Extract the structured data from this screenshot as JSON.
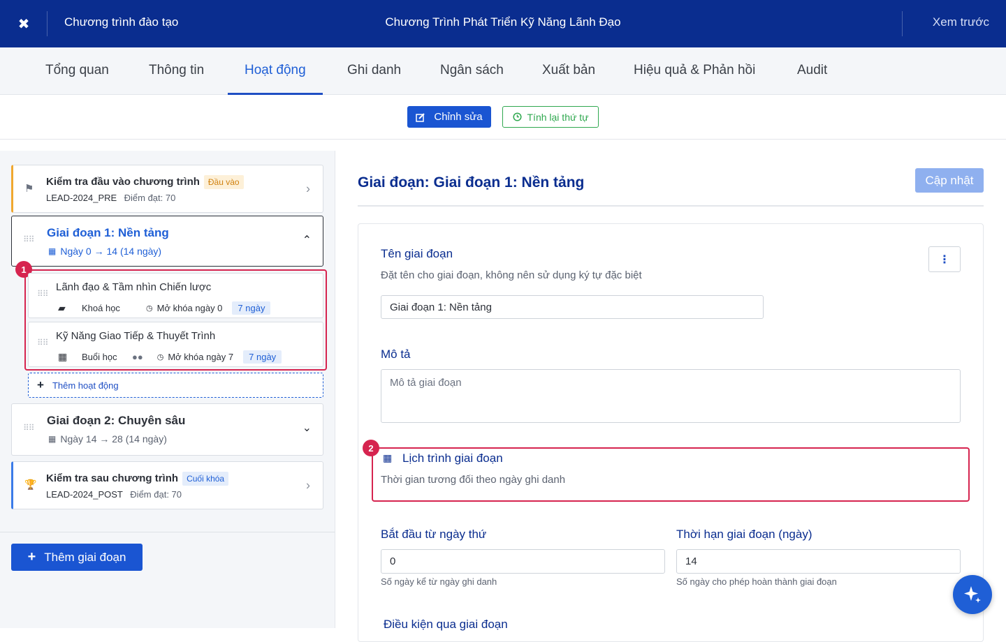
{
  "header": {
    "close_icon": "✖",
    "breadcrumb": "Chương trình đào tạo",
    "title": "Chương Trình Phát Triển Kỹ Năng Lãnh Đạo",
    "preview": "Xem trước"
  },
  "tabs": [
    {
      "label": "Tổng quan"
    },
    {
      "label": "Thông tin"
    },
    {
      "label": "Hoạt động"
    },
    {
      "label": "Ghi danh"
    },
    {
      "label": "Ngân sách"
    },
    {
      "label": "Xuất bản"
    },
    {
      "label": "Hiệu quả & Phản hồi"
    },
    {
      "label": "Audit"
    }
  ],
  "actions": {
    "edit": "Chỉnh sửa",
    "reorder": "Tính lại thứ tự"
  },
  "sidebar": {
    "pre_test": {
      "title": "Kiểm tra đầu vào chương trình",
      "badge": "Đầu vào",
      "code": "LEAD-2024_PRE",
      "score": "Điểm đạt: 70"
    },
    "phase1": {
      "title": "Giai đoạn 1: Nền tảng",
      "range": "Ngày 0 → 14 (14 ngày)",
      "activities": [
        {
          "title": "Lãnh đạo & Tầm nhìn Chiến lược",
          "type": "Khoá học",
          "unlock": "Mở khóa ngày 0",
          "days": "7 ngày"
        },
        {
          "title": "Kỹ Năng Giao Tiếp & Thuyết Trình",
          "type": "Buổi học",
          "unlock": "Mở khóa ngày 7",
          "days": "7 ngày"
        }
      ],
      "add_activity": "Thêm hoạt động"
    },
    "phase2": {
      "title": "Giai đoạn 2: Chuyên sâu",
      "range": "Ngày 14 → 28 (14 ngày)"
    },
    "post_test": {
      "title": "Kiểm tra sau chương trình",
      "badge": "Cuối khóa",
      "code": "LEAD-2024_POST",
      "score": "Điểm đạt: 70"
    },
    "add_phase": "Thêm giai đoạn",
    "markers": [
      "1",
      "2"
    ]
  },
  "detail": {
    "heading": "Giai đoạn: Giai đoạn 1: Nền tảng",
    "update": "Cập nhật",
    "name_label": "Tên giai đoạn",
    "name_hint": "Đặt tên cho giai đoạn, không nên sử dụng ký tự đặc biệt",
    "name_value": "Giai đoạn 1: Nền tảng",
    "desc_label": "Mô tả",
    "desc_placeholder": "Mô tả giai đoạn",
    "schedule_label": "Lịch trình giai đoạn",
    "schedule_hint": "Thời gian tương đối theo ngày ghi danh",
    "start_label": "Bắt đầu từ ngày thứ",
    "start_value": "0",
    "start_hint": "Số ngày kể từ ngày ghi danh",
    "duration_label": "Thời hạn giai đoạn (ngày)",
    "duration_value": "14",
    "duration_hint": "Số ngày cho phép hoàn thành giai đoạn",
    "condition_label": "Điều kiện qua giai đoạn"
  },
  "colors": {
    "header_bg": "#0a2d8f",
    "primary": "#1a55d2",
    "success": "#2fa84f",
    "highlight": "#d6244f"
  }
}
